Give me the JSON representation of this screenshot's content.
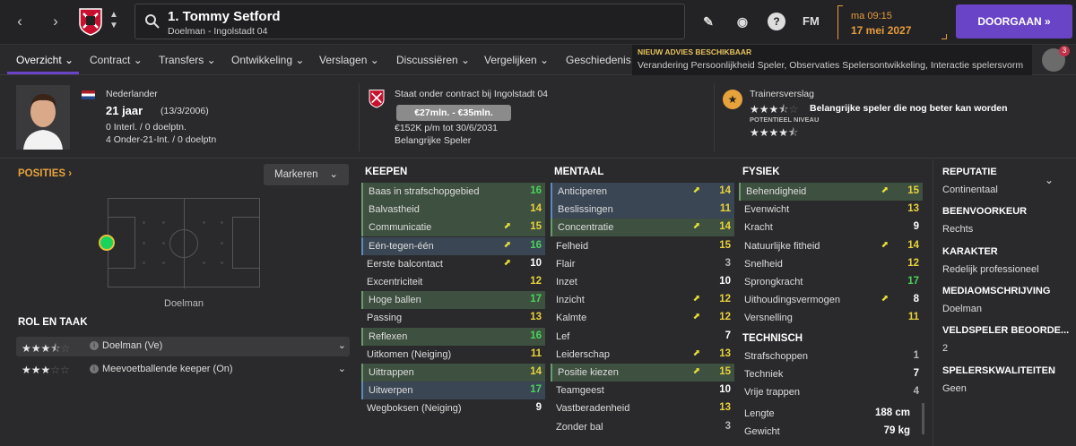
{
  "header": {
    "player_name": "1. Tommy Setford",
    "player_sub": "Doelman - Ingolstadt 04",
    "fm_label": "FM",
    "time": "ma 09:15",
    "date": "17 mei 2027",
    "continue_label": "DOORGAAN",
    "back_icon": "chevron-left-icon",
    "forward_icon": "chevron-right-icon"
  },
  "tabs": [
    {
      "label": "Overzicht"
    },
    {
      "label": "Contract"
    },
    {
      "label": "Transfers"
    },
    {
      "label": "Ontwikkeling"
    },
    {
      "label": "Verslagen"
    },
    {
      "label": "Discussiëren"
    },
    {
      "label": "Vergelijken"
    },
    {
      "label": "Geschiedenis"
    }
  ],
  "advies": {
    "heading": "NIEUW ADVIES BESCHIKBAAR",
    "body": "Verandering Persoonlijkheid Speler, Observaties Spelersontwikkeling, Interactie spelersvorm",
    "badge_count": "3"
  },
  "info": {
    "nationality": "Nederlander",
    "age": "21 jaar",
    "dob": "(13/3/2006)",
    "caps": "0 Interl. / 0 doelptn.",
    "u21": "4 Onder-21-Int. / 0 doelptn",
    "contract": "Staat onder contract bij Ingolstadt 04",
    "value": "€27mln. - €35mln.",
    "wage": "€152K p/m tot 30/6/2031",
    "status": "Belangrijke Speler",
    "report_label": "Trainersverslag",
    "report_text": "Belangrijke speler die nog beter kan worden",
    "potential_label": "POTENTIEEL NIVEAU",
    "current_stars": 3.5,
    "potential_stars": 4.5
  },
  "left": {
    "posities": "POSITIES",
    "markeren": "Markeren",
    "position_label": "Doelman",
    "rol_title": "ROL EN TAAK",
    "roles": [
      {
        "label": "Doelman (Ve)",
        "stars": 3.5
      },
      {
        "label": "Meevoetballende keeper (On)",
        "stars": 3
      }
    ]
  },
  "keepen": {
    "title": "KEEPEN",
    "rows": [
      {
        "name": "Baas in strafschopgebied",
        "value": "16",
        "hl": "g",
        "color": "gr",
        "arrow": false
      },
      {
        "name": "Balvastheid",
        "value": "14",
        "hl": "g",
        "color": "y",
        "arrow": false
      },
      {
        "name": "Communicatie",
        "value": "15",
        "hl": "g",
        "color": "y",
        "arrow": true
      },
      {
        "name": "Eén-tegen-één",
        "value": "16",
        "hl": "b",
        "color": "gr",
        "arrow": true
      },
      {
        "name": "Eerste balcontact",
        "value": "10",
        "hl": "",
        "color": "w",
        "arrow": true
      },
      {
        "name": "Excentriciteit",
        "value": "12",
        "hl": "",
        "color": "y",
        "arrow": false
      },
      {
        "name": "Hoge ballen",
        "value": "17",
        "hl": "g",
        "color": "gr",
        "arrow": false
      },
      {
        "name": "Passing",
        "value": "13",
        "hl": "",
        "color": "y",
        "arrow": false
      },
      {
        "name": "Reflexen",
        "value": "16",
        "hl": "g",
        "color": "gr",
        "arrow": false
      },
      {
        "name": "Uitkomen (Neiging)",
        "value": "11",
        "hl": "",
        "color": "y",
        "arrow": false
      },
      {
        "name": "Uittrappen",
        "value": "14",
        "hl": "g",
        "color": "y",
        "arrow": false
      },
      {
        "name": "Uitwerpen",
        "value": "17",
        "hl": "b",
        "color": "gr",
        "arrow": false
      },
      {
        "name": "Wegboksen (Neiging)",
        "value": "9",
        "hl": "",
        "color": "w",
        "arrow": false
      }
    ]
  },
  "mentaal": {
    "title": "MENTAAL",
    "rows": [
      {
        "name": "Anticiperen",
        "value": "14",
        "hl": "b",
        "color": "y",
        "arrow": true
      },
      {
        "name": "Beslissingen",
        "value": "11",
        "hl": "b",
        "color": "y",
        "arrow": false
      },
      {
        "name": "Concentratie",
        "value": "14",
        "hl": "g",
        "color": "y",
        "arrow": true
      },
      {
        "name": "Felheid",
        "value": "15",
        "hl": "",
        "color": "y",
        "arrow": false
      },
      {
        "name": "Flair",
        "value": "3",
        "hl": "",
        "color": "g",
        "arrow": false
      },
      {
        "name": "Inzet",
        "value": "10",
        "hl": "",
        "color": "w",
        "arrow": false
      },
      {
        "name": "Inzicht",
        "value": "12",
        "hl": "",
        "color": "y",
        "arrow": true
      },
      {
        "name": "Kalmte",
        "value": "12",
        "hl": "",
        "color": "y",
        "arrow": true
      },
      {
        "name": "Lef",
        "value": "7",
        "hl": "",
        "color": "w",
        "arrow": false
      },
      {
        "name": "Leiderschap",
        "value": "13",
        "hl": "",
        "color": "y",
        "arrow": true
      },
      {
        "name": "Positie kiezen",
        "value": "15",
        "hl": "g",
        "color": "y",
        "arrow": true
      },
      {
        "name": "Teamgeest",
        "value": "10",
        "hl": "",
        "color": "w",
        "arrow": false
      },
      {
        "name": "Vastberadenheid",
        "value": "13",
        "hl": "",
        "color": "y",
        "arrow": false
      },
      {
        "name": "Zonder bal",
        "value": "3",
        "hl": "",
        "color": "g",
        "arrow": false
      }
    ]
  },
  "fysiek": {
    "title": "FYSIEK",
    "rows": [
      {
        "name": "Behendigheid",
        "value": "15",
        "hl": "g",
        "color": "y",
        "arrow": true
      },
      {
        "name": "Evenwicht",
        "value": "13",
        "hl": "",
        "color": "y",
        "arrow": false
      },
      {
        "name": "Kracht",
        "value": "9",
        "hl": "",
        "color": "w",
        "arrow": false
      },
      {
        "name": "Natuurlijke fitheid",
        "value": "14",
        "hl": "",
        "color": "y",
        "arrow": true
      },
      {
        "name": "Snelheid",
        "value": "12",
        "hl": "",
        "color": "y",
        "arrow": false
      },
      {
        "name": "Sprongkracht",
        "value": "17",
        "hl": "",
        "color": "gr",
        "arrow": false
      },
      {
        "name": "Uithoudingsvermogen",
        "value": "8",
        "hl": "",
        "color": "w",
        "arrow": true
      },
      {
        "name": "Versnelling",
        "value": "11",
        "hl": "",
        "color": "y",
        "arrow": false
      }
    ]
  },
  "technisch": {
    "title": "TECHNISCH",
    "rows": [
      {
        "name": "Strafschoppen",
        "value": "1",
        "hl": "",
        "color": "g",
        "arrow": false
      },
      {
        "name": "Techniek",
        "value": "7",
        "hl": "",
        "color": "w",
        "arrow": false
      },
      {
        "name": "Vrije trappen",
        "value": "4",
        "hl": "",
        "color": "g",
        "arrow": false
      }
    ]
  },
  "measures": [
    {
      "name": "Lengte",
      "value": "188 cm"
    },
    {
      "name": "Gewicht",
      "value": "79 kg"
    }
  ],
  "right": [
    {
      "h": "REPUTATIE",
      "v": "Continentaal"
    },
    {
      "h": "BEENVOORKEUR",
      "v": "Rechts"
    },
    {
      "h": "KARAKTER",
      "v": "Redelijk professioneel"
    },
    {
      "h": "MEDIAOMSCHRIJVING",
      "v": "Doelman"
    },
    {
      "h": "VELDSPELER BEOORDE...",
      "v": "2"
    },
    {
      "h": "SPELERSKWALITEITEN",
      "v": "Geen"
    }
  ],
  "colors": {
    "accent": "#6a44c7",
    "orange": "#e89a3c",
    "green": "#4bd35a",
    "yellow": "#e8d23c"
  }
}
